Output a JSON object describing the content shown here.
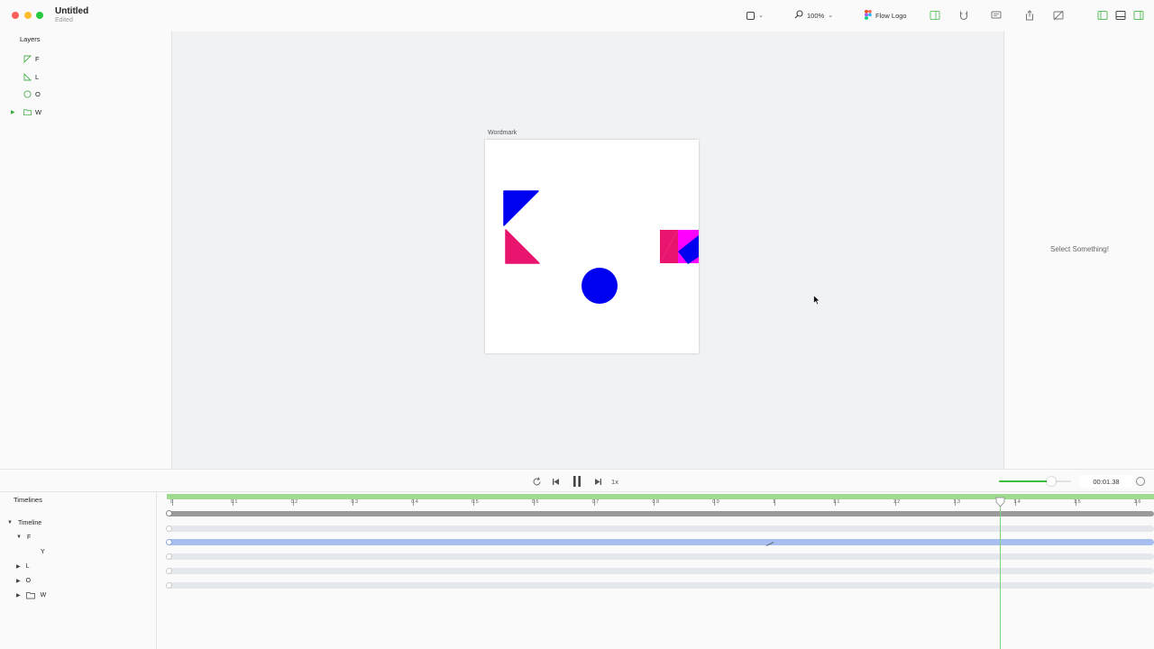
{
  "window": {
    "title": "Untitled",
    "subtitle": "Edited"
  },
  "toolbar": {
    "zoom": "100%",
    "component_name": "Flow Logo"
  },
  "layers": {
    "title": "Layers",
    "items": [
      {
        "label": "F",
        "icon": "triangle-shape-icon"
      },
      {
        "label": "L",
        "icon": "triangle-shape-icon"
      },
      {
        "label": "O",
        "icon": "ellipse-shape-icon"
      },
      {
        "label": "W",
        "icon": "folder-icon"
      }
    ]
  },
  "canvas": {
    "frame_label": "Wordmark"
  },
  "inspector": {
    "empty_message": "Select Something!"
  },
  "playback": {
    "speed": "1x",
    "time": "00:01.38",
    "volume": 0.72
  },
  "timelines": {
    "title": "Timelines",
    "rows": [
      {
        "label": "Timeline"
      },
      {
        "label": "F"
      },
      {
        "label": "Y"
      },
      {
        "label": "L"
      },
      {
        "label": "O"
      },
      {
        "label": "W"
      }
    ],
    "ruler_labels": [
      "0",
      "0.1",
      "0.2",
      "0.3",
      "0.4",
      "0.5",
      "0.6",
      "0.7",
      "0.8",
      "0.9",
      "1",
      "1.1",
      "1.2",
      "1.3",
      "1.4",
      "1.5",
      "1.6"
    ]
  },
  "colors": {
    "accent": "#3bbd3b",
    "blue_shape": "#0000f0",
    "pink_shape": "#e8146e",
    "magenta_shape": "#ff00ff",
    "track_selected": "#a6bff0"
  }
}
